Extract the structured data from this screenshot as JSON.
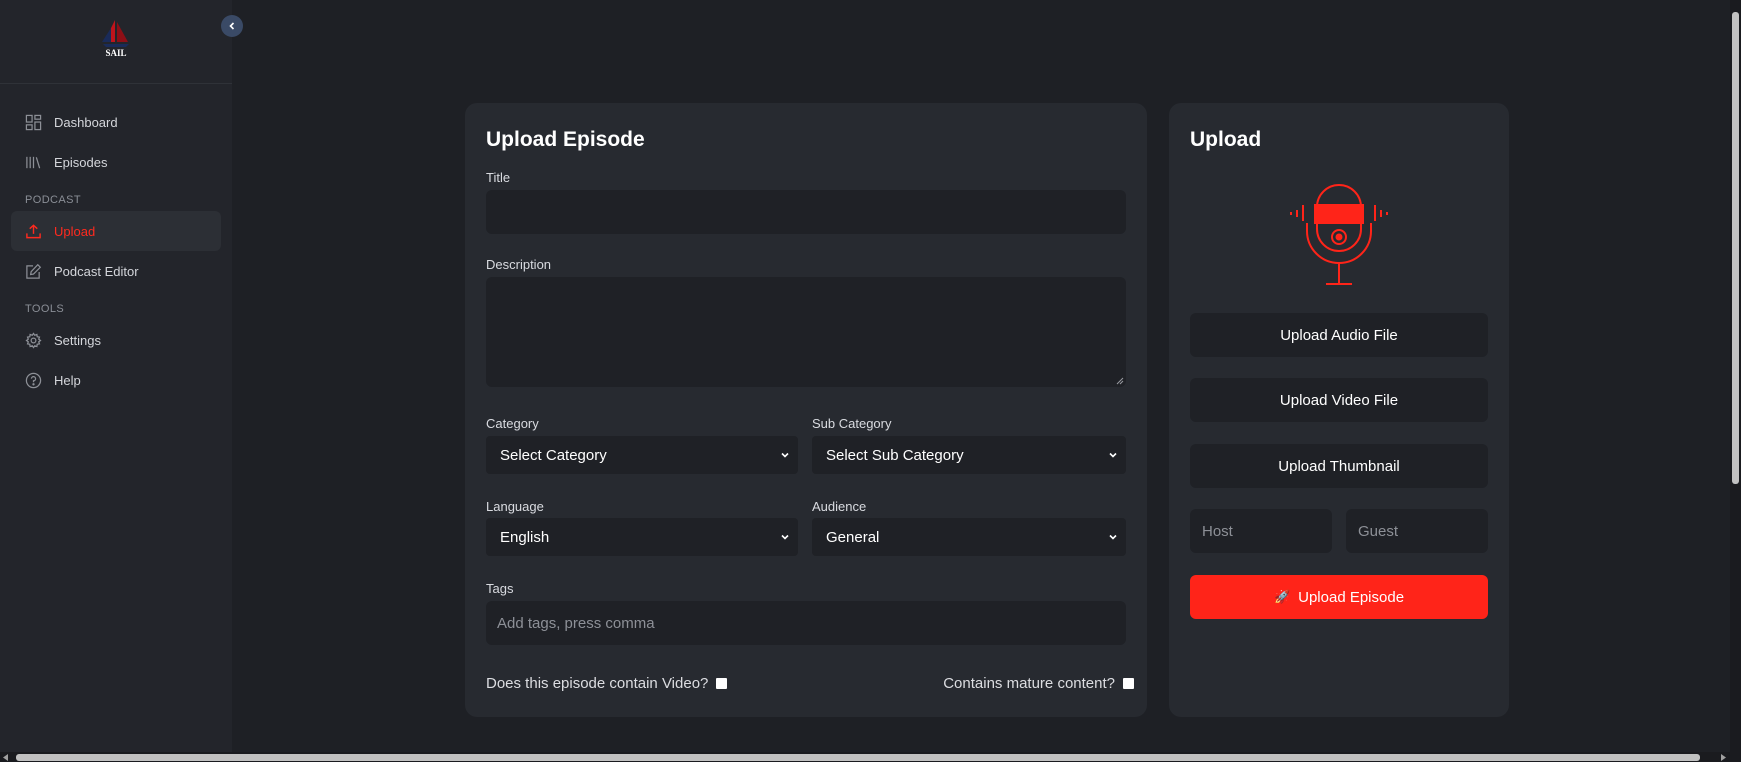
{
  "brand": {
    "logo_text": "SAIL"
  },
  "sidebar": {
    "items": [
      {
        "label": "Dashboard",
        "icon": "dashboard-icon"
      },
      {
        "label": "Episodes",
        "icon": "library-icon"
      }
    ],
    "section_podcast": "PODCAST",
    "podcast_items": [
      {
        "label": "Upload",
        "icon": "upload-icon",
        "active": true
      },
      {
        "label": "Podcast Editor",
        "icon": "edit-icon"
      }
    ],
    "section_tools": "TOOLS",
    "tools_items": [
      {
        "label": "Settings",
        "icon": "gear-icon"
      },
      {
        "label": "Help",
        "icon": "help-icon"
      }
    ]
  },
  "form": {
    "heading": "Upload Episode",
    "title_label": "Title",
    "title_value": "",
    "description_label": "Description",
    "description_value": "",
    "category_label": "Category",
    "category_value": "Select Category",
    "subcategory_label": "Sub Category",
    "subcategory_value": "Select Sub Category",
    "language_label": "Language",
    "language_value": "English",
    "audience_label": "Audience",
    "audience_value": "General",
    "tags_label": "Tags",
    "tags_placeholder": "Add tags, press comma",
    "video_question": "Does this episode contain Video?",
    "mature_question": "Contains mature content?"
  },
  "upload_panel": {
    "heading": "Upload",
    "illustration": "podcast-microphone-icon",
    "audio_button": "Upload Audio File",
    "video_button": "Upload Video File",
    "thumbnail_button": "Upload Thumbnail",
    "host_placeholder": "Host",
    "guest_placeholder": "Guest",
    "submit_button": "Upload Episode",
    "submit_icon": "rocket-icon"
  },
  "colors": {
    "accent": "#ff2419",
    "background": "#1e2025",
    "sidebar": "#23252b",
    "card": "#272a30",
    "input": "#1f2126"
  }
}
